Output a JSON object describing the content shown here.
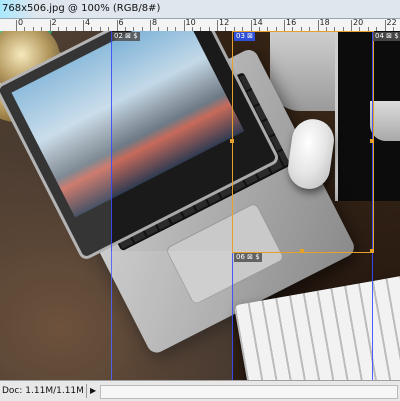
{
  "window": {
    "title": "768x506.jpg @ 100% (RGB/8#)"
  },
  "ruler": {
    "labels": [
      "0",
      "2",
      "4",
      "6",
      "8",
      "10",
      "12",
      "14",
      "16",
      "18",
      "20",
      "22"
    ]
  },
  "slices": [
    {
      "id": "02",
      "icons": "⊠ $",
      "active": false
    },
    {
      "id": "03",
      "icons": "⊠",
      "active": true
    },
    {
      "id": "04",
      "icons": "⊠ $",
      "active": false
    },
    {
      "id": "06",
      "icons": "⊠ $",
      "active": false
    }
  ],
  "statusbar": {
    "doc_label": "Doc: 1.11M/1.11M",
    "arrow": "▶"
  },
  "colors": {
    "slice_border": "#e6a12a",
    "guide": "#3a4dff",
    "active_label": "#3050d8"
  }
}
